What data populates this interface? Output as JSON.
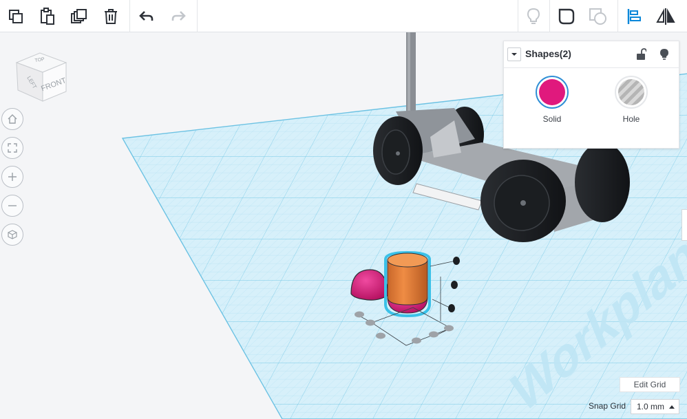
{
  "app": {
    "toolbar": {
      "left_tools": [
        {
          "icon": "copy-icon",
          "label": "Copy"
        },
        {
          "icon": "paste-icon",
          "label": "Paste"
        },
        {
          "icon": "duplicate-icon",
          "label": "Duplicate"
        },
        {
          "icon": "trash-icon",
          "label": "Delete"
        }
      ],
      "history_tools": [
        {
          "icon": "undo-icon",
          "enabled": true
        },
        {
          "icon": "redo-icon",
          "enabled": false
        }
      ],
      "right_tools": [
        {
          "icon": "lightbulb-icon",
          "enabled": false
        },
        {
          "icon": "group-icon",
          "enabled": true
        },
        {
          "icon": "ungroup-icon",
          "enabled": false
        },
        {
          "icon": "align-icon",
          "enabled": true
        },
        {
          "icon": "mirror-icon",
          "enabled": true
        }
      ]
    },
    "viewcube": {
      "top": "TOP",
      "front": "FRONT",
      "left": "LEFT"
    },
    "nav_buttons": [
      "home-icon",
      "fit-view-icon",
      "zoom-in-icon",
      "zoom-out-icon",
      "perspective-icon"
    ],
    "shapes_panel": {
      "title": "Shapes(2)",
      "solid_label": "Solid",
      "hole_label": "Hole",
      "solid_color": "#e0197d",
      "hole_color": "#b9b9b9"
    },
    "workplane": {
      "watermark": "Workplane",
      "grid_color": "#8fd3ec",
      "plane_color": "#d8f1fb"
    },
    "bottom_controls": {
      "edit_grid_label": "Edit Grid",
      "snap_grid_label": "Snap Grid",
      "snap_grid_value": "1.0 mm"
    },
    "colors": {
      "accent": "#0a87d9",
      "selected_orange": "#ef8c44",
      "magenta": "#e0197d"
    }
  }
}
